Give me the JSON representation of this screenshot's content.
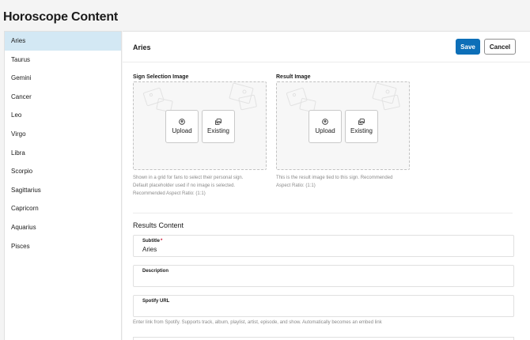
{
  "page": {
    "title": "Horoscope Content"
  },
  "sidebar": {
    "items": [
      {
        "label": "Aries",
        "active": true
      },
      {
        "label": "Taurus"
      },
      {
        "label": "Gemini"
      },
      {
        "label": "Cancer"
      },
      {
        "label": "Leo"
      },
      {
        "label": "Virgo"
      },
      {
        "label": "Libra"
      },
      {
        "label": "Scorpio"
      },
      {
        "label": "Sagittarius"
      },
      {
        "label": "Capricorn"
      },
      {
        "label": "Aquarius"
      },
      {
        "label": "Pisces"
      }
    ]
  },
  "header": {
    "title": "Aries",
    "save_label": "Save",
    "cancel_label": "Cancel"
  },
  "sign_image": {
    "label": "Sign Selection Image",
    "upload_label": "Upload",
    "existing_label": "Existing",
    "help_lines": [
      "Shown in a grid for fans to select their personal sign.",
      "Default placeholder used if no image is selected.",
      "Recommended Aspect Ratio: (1:1)"
    ]
  },
  "result_image": {
    "label": "Result Image",
    "upload_label": "Upload",
    "existing_label": "Existing",
    "help_lines": [
      "This is the result image tied to this sign. Recommended",
      "Aspect Ratio: (1:1)"
    ]
  },
  "results": {
    "section_title": "Results Content",
    "subtitle_label": "Subtitle",
    "required_mark": "*",
    "subtitle_value": "Aries",
    "description_label": "Description",
    "description_value": "",
    "spotify_label": "Spotify URL",
    "spotify_value": "",
    "spotify_help": "Enter link from Spotify. Supports track, album, playlist, artist, episode, and show. Automatically becomes an embed link"
  },
  "icons": {
    "upload": "upload-icon",
    "existing": "gallery-icon",
    "placeholder": "image-placeholder-icon"
  },
  "colors": {
    "accent": "#0d6fb8",
    "active_item": "#d3e8f4",
    "required": "#c8102e"
  }
}
